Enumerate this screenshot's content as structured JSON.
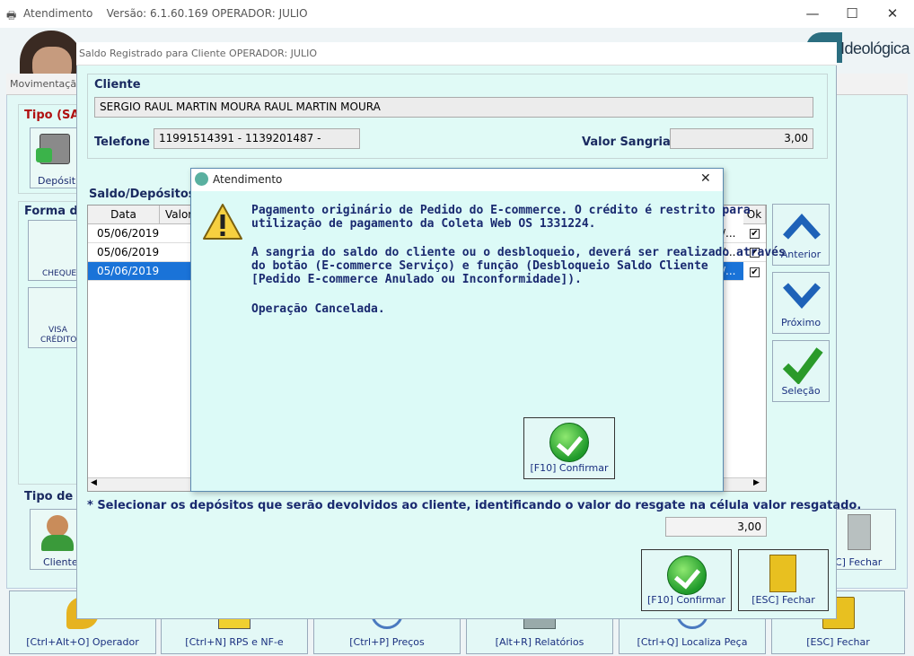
{
  "app": {
    "title": "Atendimento",
    "version": "Versão: 6.1.60.169 OPERADOR:  JULIO",
    "logo": "Ideológica",
    "window_controls": [
      "—",
      "☐",
      "✕"
    ]
  },
  "movimentacao": {
    "title": "Movimentaçã",
    "tipo_label": "Tipo (SAL",
    "deposito_tile": "Depósit",
    "forma_label": "Forma de",
    "cheque_tile": "CHEQUE",
    "visa_tile": [
      "VISA",
      "CRÉDITO"
    ],
    "tipo_p_label": "Tipo de P",
    "cliente_tile": "Cliente",
    "fechar_right": "C] Fechar"
  },
  "toolbar": [
    {
      "label": "[Ctrl+Alt+O] Operador",
      "icon": "key-icon"
    },
    {
      "label": "[Ctrl+N] RPS e NF-e",
      "icon": "warning-doc-icon"
    },
    {
      "label": "[Ctrl+P] Preços",
      "icon": "search-price-icon"
    },
    {
      "label": "[Alt+R] Relatórios",
      "icon": "printer-icon"
    },
    {
      "label": "[Ctrl+Q] Localiza Peça",
      "icon": "magnifier-icon"
    },
    {
      "label": "[ESC] Fechar",
      "icon": "door-icon"
    }
  ],
  "saldo": {
    "title": "Saldo Registrado para Cliente OPERADOR: JULIO",
    "cliente_label": "Cliente",
    "cliente_value": "SERGIO RAUL MARTIN MOURA RAUL MARTIN MOURA",
    "telefone_label": "Telefone",
    "telefone_value": "11991514391 - 1139201487 -",
    "valor_label": "Valor Sangria",
    "valor_value": "3,00",
    "section_label": "Saldo/Depósitos",
    "grid_headers": [
      "Data",
      "Valor",
      "Ok"
    ],
    "rows": [
      {
        "date": "05/06/2019",
        "trail": "/...",
        "ok": true,
        "selected": false
      },
      {
        "date": "05/06/2019",
        "trail": "/...",
        "ok": true,
        "selected": false
      },
      {
        "date": "05/06/2019",
        "trail": "/...",
        "ok": true,
        "selected": true
      }
    ],
    "note": "* Selecionar os depósitos que serão devolvidos ao cliente, identificando o valor do resgate na célula valor resgatado.",
    "total_value": "3,00",
    "nav": {
      "anterior": "Anterior",
      "proximo": "Próximo",
      "selecao": "Seleção"
    },
    "confirm_label": "[F10] Confirmar",
    "fechar_label": "[ESC] Fechar"
  },
  "alert": {
    "title": "Atendimento",
    "close": "✕",
    "paragraph1": [
      "Pagamento originário de Pedido do E-commerce. O crédito é restrito para",
      "utilização de pagamento da Coleta Web OS 1331224."
    ],
    "paragraph2": [
      "A sangria do saldo do cliente ou o desbloqueio, deverá ser realizado através",
      "do botão (E-commerce Serviço) e função (Desbloqueio Saldo Cliente",
      "[Pedido E-commerce Anulado ou Inconformidade])."
    ],
    "paragraph3": "Operação Cancelada.",
    "confirm_label": "[F10] Confirmar"
  }
}
